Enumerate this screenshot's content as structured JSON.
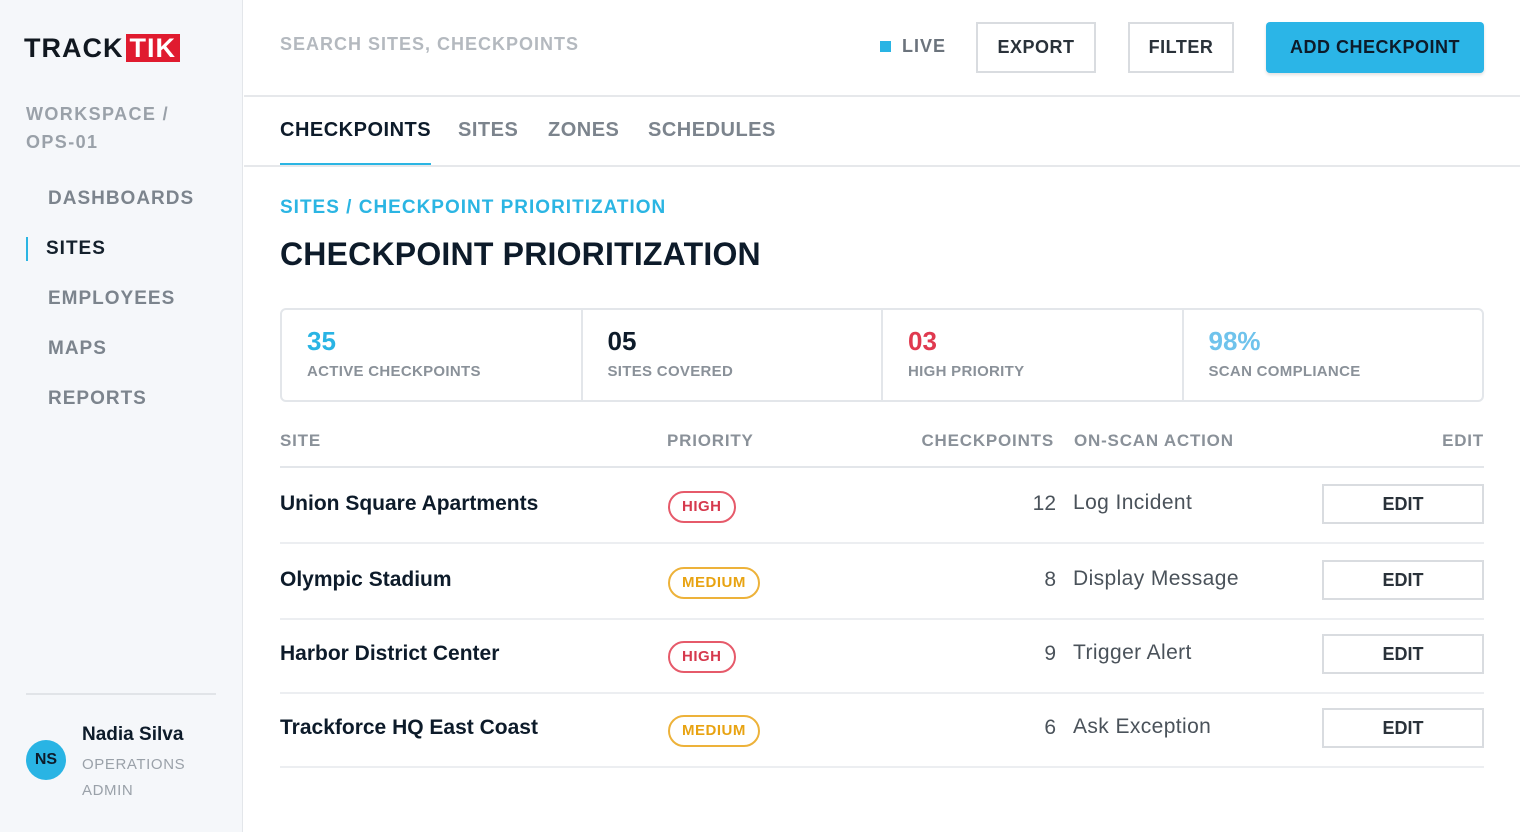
{
  "brand": {
    "track": "TRACK",
    "tik": "TIK"
  },
  "workspace": {
    "label": "WORKSPACE / OPS-01"
  },
  "sidebar": {
    "items": [
      {
        "label": "DASHBOARDS",
        "active": false
      },
      {
        "label": "SITES",
        "active": true
      },
      {
        "label": "EMPLOYEES",
        "active": false
      },
      {
        "label": "MAPS",
        "active": false
      },
      {
        "label": "REPORTS",
        "active": false
      }
    ]
  },
  "user": {
    "initials": "NS",
    "name": "Nadia Silva",
    "role": "OPERATIONS ADMIN"
  },
  "topbar": {
    "search_placeholder": "SEARCH SITES, CHECKPOINTS",
    "live_label": "LIVE",
    "export_label": "EXPORT",
    "filter_label": "FILTER",
    "add_label": "ADD CHECKPOINT"
  },
  "tabs": [
    {
      "label": "CHECKPOINTS",
      "active": true
    },
    {
      "label": "SITES",
      "active": false
    },
    {
      "label": "ZONES",
      "active": false
    },
    {
      "label": "SCHEDULES",
      "active": false
    }
  ],
  "breadcrumb": "SITES / CHECKPOINT PRIORITIZATION",
  "page_title": "CHECKPOINT PRIORITIZATION",
  "stats": [
    {
      "value": "35",
      "label": "ACTIVE CHECKPOINTS",
      "color": "#29b4e4"
    },
    {
      "value": "05",
      "label": "SITES COVERED",
      "color": "#0d1b2a"
    },
    {
      "value": "03",
      "label": "HIGH PRIORITY",
      "color": "#e0394f"
    },
    {
      "value": "98%",
      "label": "SCAN COMPLIANCE",
      "color": "#6fc3ec"
    }
  ],
  "table": {
    "headers": {
      "site": "SITE",
      "priority": "PRIORITY",
      "checkpoints": "CHECKPOINTS",
      "action": "ON-SCAN ACTION",
      "edit": "EDIT"
    },
    "rows": [
      {
        "site": "Union Square Apartments",
        "priority": "HIGH",
        "level": "high",
        "checkpoints": "12",
        "action": "Log Incident",
        "edit": "EDIT"
      },
      {
        "site": "Olympic Stadium",
        "priority": "MEDIUM",
        "level": "medium",
        "checkpoints": "8",
        "action": "Display Message",
        "edit": "EDIT"
      },
      {
        "site": "Harbor District Center",
        "priority": "HIGH",
        "level": "high",
        "checkpoints": "9",
        "action": "Trigger Alert",
        "edit": "EDIT"
      },
      {
        "site": "Trackforce HQ East Coast",
        "priority": "MEDIUM",
        "level": "medium",
        "checkpoints": "6",
        "action": "Ask Exception",
        "edit": "EDIT"
      }
    ]
  },
  "colors": {
    "accent": "#2bb5e3",
    "high": "#d63a4e",
    "medium": "#e8a312",
    "brand_red": "#e01b2f"
  }
}
